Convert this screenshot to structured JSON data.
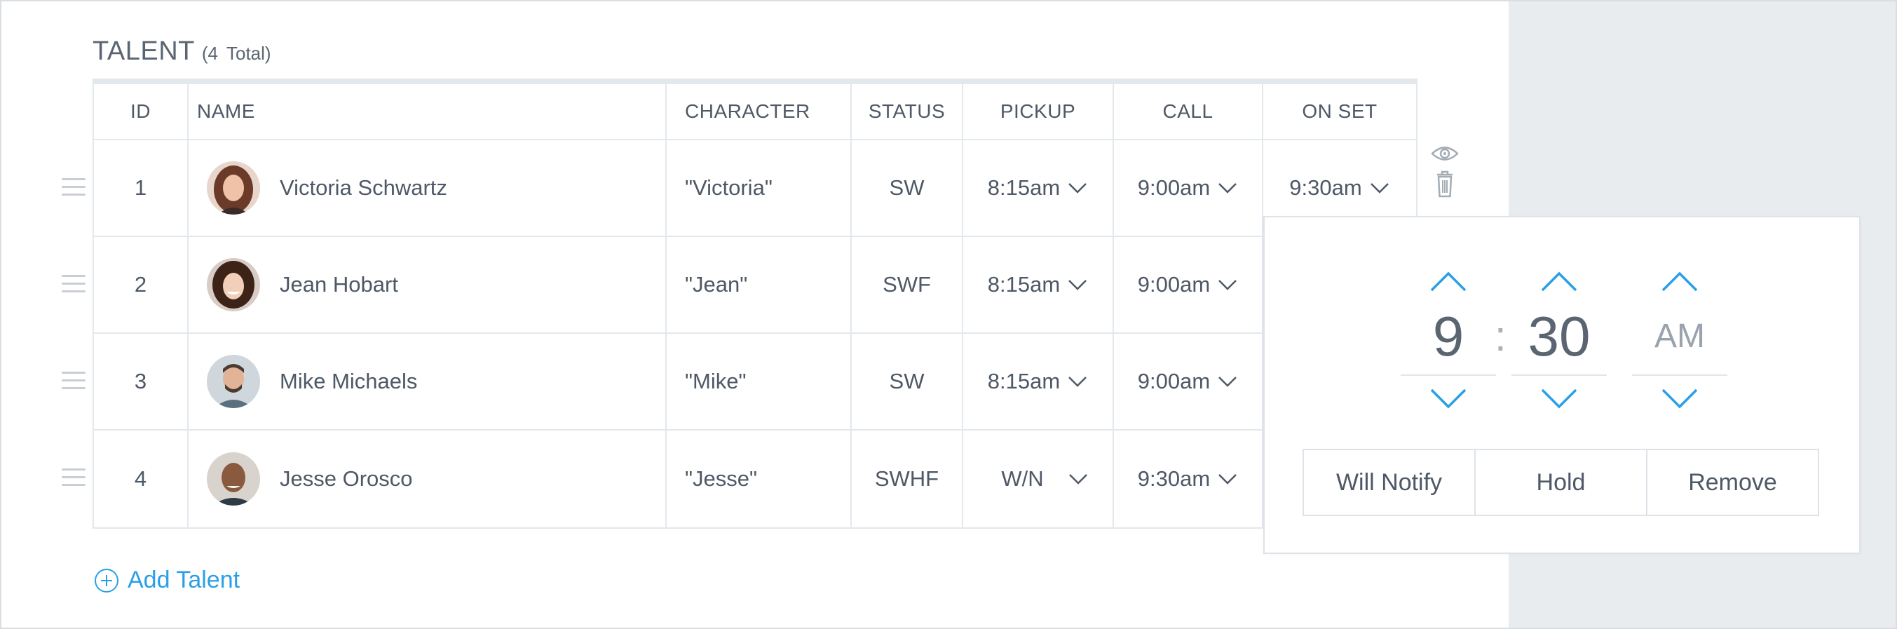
{
  "section": {
    "title": "TALENT",
    "count_open": "(4",
    "count_close": "Total)"
  },
  "table": {
    "columns": [
      "ID",
      "NAME",
      "CHARACTER",
      "STATUS",
      "PICKUP",
      "CALL",
      "ON SET"
    ],
    "rows": [
      {
        "id": "1",
        "name": "Victoria Schwartz",
        "character": "\"Victoria\"",
        "status": "SW",
        "pickup": "8:15am",
        "call": "9:00am",
        "onset": "9:30am"
      },
      {
        "id": "2",
        "name": "Jean Hobart",
        "character": "\"Jean\"",
        "status": "SWF",
        "pickup": "8:15am",
        "call": "9:00am",
        "onset": ""
      },
      {
        "id": "3",
        "name": "Mike Michaels",
        "character": "\"Mike\"",
        "status": "SW",
        "pickup": "8:15am",
        "call": "9:00am",
        "onset": ""
      },
      {
        "id": "4",
        "name": "Jesse Orosco",
        "character": "\"Jesse\"",
        "status": "SWHF",
        "pickup": "W/N",
        "call": "9:30am",
        "onset": ""
      }
    ]
  },
  "row_actions": {
    "view_icon": "eye-icon",
    "delete_icon": "trash-icon"
  },
  "time_picker": {
    "hour": "9",
    "separator": ":",
    "minute": "30",
    "period": "AM",
    "buttons": [
      "Will Notify",
      "Hold",
      "Remove"
    ]
  },
  "add_talent": {
    "label": "Add Talent",
    "icon": "plus-circle-icon"
  },
  "colors": {
    "accent": "#2a9fe6",
    "border": "#e3e8ec",
    "text": "#4e5866",
    "side_panel": "#e9ecef"
  }
}
